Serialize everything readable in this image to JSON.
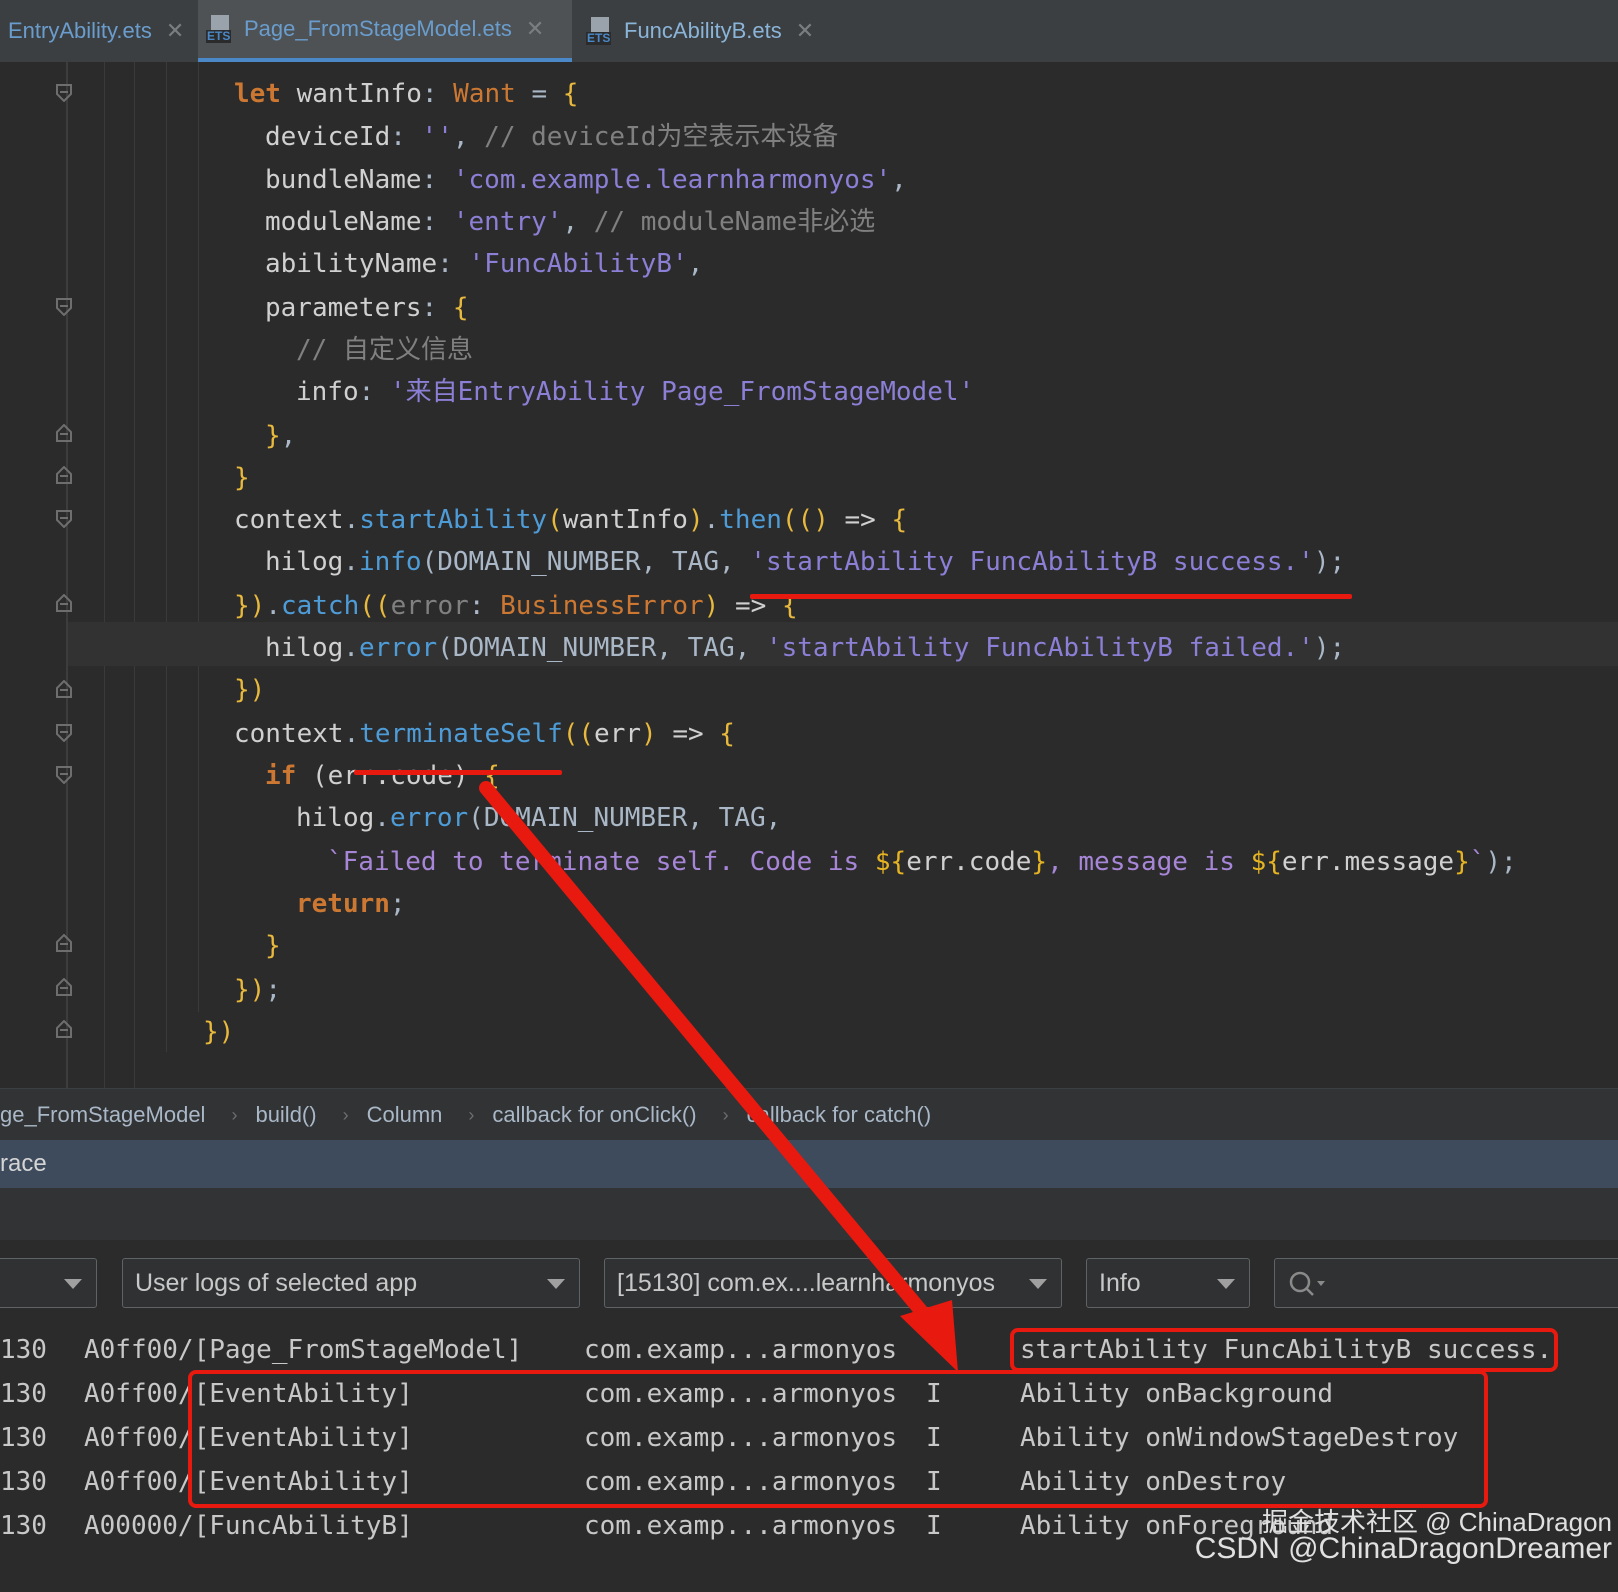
{
  "tabs": [
    {
      "label": "EntryAbility.ets",
      "icon": "none",
      "active": false
    },
    {
      "label": "Page_FromStageModel.ets",
      "icon": "ets-file-icon",
      "active": true
    },
    {
      "label": "FuncAbilityB.ets",
      "icon": "ets-file-icon",
      "active": false
    }
  ],
  "ets_icon_text": "ETS",
  "code": {
    "l1": {
      "a": "let ",
      "b": "wantInfo",
      "c": ": ",
      "d": "Want",
      "e": " = ",
      "f": "{"
    },
    "l2": {
      "a": "deviceId",
      "b": ": ",
      "c": "''",
      "d": ", ",
      "e": "// deviceId为空表示本设备"
    },
    "l3": {
      "a": "bundleName",
      "b": ": ",
      "c": "'com.example.learnharmonyos'",
      "d": ","
    },
    "l4": {
      "a": "moduleName",
      "b": ": ",
      "c": "'entry'",
      "d": ", ",
      "e": "// moduleName非必选"
    },
    "l5": {
      "a": "abilityName",
      "b": ": ",
      "c": "'FuncAbilityB'",
      "d": ","
    },
    "l6": {
      "a": "parameters",
      "b": ": ",
      "c": "{"
    },
    "l7": {
      "a": "// 自定义信息"
    },
    "l8": {
      "a": "info",
      "b": ": ",
      "c": "'来自EntryAbility Page_FromStageModel'"
    },
    "l9": {
      "a": "}",
      "b": ","
    },
    "l10": {
      "a": "}"
    },
    "l11": {
      "a": "context",
      "b": ".",
      "c": "startAbility",
      "d": "(",
      "e": "wantInfo",
      "f": ")",
      "g": ".",
      "h": "then",
      "i": "(() ",
      "j": "=> ",
      "k": "{"
    },
    "l12": {
      "a": "hilog",
      "b": ".",
      "c": "info",
      "d": "(DOMAIN_NUMBER, TAG, ",
      "e": "'startAbility FuncAbilityB success.'",
      "f": ");"
    },
    "l13": {
      "a": "})",
      "b": ".",
      "c": "catch",
      "d": "((",
      "e": "error",
      "f": ": ",
      "g": "BusinessError",
      "h": ") ",
      "i": "=> ",
      "j": "{"
    },
    "l14": {
      "a": "hilog",
      "b": ".",
      "c": "error",
      "d": "(DOMAIN_NUMBER, TAG, ",
      "e": "'startAbility FuncAbilityB failed.'",
      "f": ");"
    },
    "l15": {
      "a": "})"
    },
    "l16": {
      "a": "context",
      "b": ".",
      "c": "terminateSelf",
      "d": "((",
      "e": "err",
      "f": ") ",
      "g": "=> ",
      "h": "{"
    },
    "l17": {
      "a": "if ",
      "b": "(err.code) ",
      "c": "{"
    },
    "l18": {
      "a": "hilog",
      "b": ".",
      "c": "error",
      "d": "(DOMAIN_NUMBER, TAG,"
    },
    "l19": {
      "a": "`Failed to terminate self. Code is ",
      "b": "${",
      "c": "err.code",
      "d": "}",
      "e": ", message is ",
      "f": "${",
      "g": "err.message",
      "h": "}",
      "i": "`",
      "j": ");"
    },
    "l20": {
      "a": "return",
      "b": ";"
    },
    "l21": {
      "a": "}"
    },
    "l22": {
      "a": "})",
      "b": ";"
    },
    "l23": {
      "a": "})"
    }
  },
  "breadcrumb": [
    "ge_FromStageModel",
    "build()",
    "Column",
    "callback for onClick()",
    "callback for catch()"
  ],
  "panel": {
    "title": "race"
  },
  "toolbar": {
    "dropdown_device": "",
    "dropdown_filter": "User logs of selected app",
    "dropdown_process": "[15130] com.ex....learnharmonyos",
    "dropdown_level": "Info",
    "search_placeholder": ""
  },
  "logs": [
    {
      "pid": "130",
      "tag": "A0ff00/[Page_FromStageModel]",
      "pkg": "com.examp...armonyos",
      "level": "I",
      "msg": "startAbility FuncAbilityB success."
    },
    {
      "pid": "130",
      "tag": "A0ff00/[EventAbility]",
      "pkg": "com.examp...armonyos",
      "level": "I",
      "msg": "Ability onBackground"
    },
    {
      "pid": "130",
      "tag": "A0ff00/[EventAbility]",
      "pkg": "com.examp...armonyos",
      "level": "I",
      "msg": "Ability onWindowStageDestroy"
    },
    {
      "pid": "130",
      "tag": "A0ff00/[EventAbility]",
      "pkg": "com.examp...armonyos",
      "level": "I",
      "msg": "Ability onDestroy"
    },
    {
      "pid": "130",
      "tag": "A00000/[FuncAbilityB]",
      "pkg": "com.examp...armonyos",
      "level": "I",
      "msg": "Ability onForeground"
    }
  ],
  "watermark": {
    "line1": "掘金技术社区 @ ChinaDragon",
    "line2": "CSDN @ChinaDragonDreamer"
  },
  "colors": {
    "annotation_red": "#e8190f",
    "keyword": "#cc7832",
    "string": "#8b7fd6",
    "function": "#4e9cd7",
    "comment": "#808080"
  }
}
